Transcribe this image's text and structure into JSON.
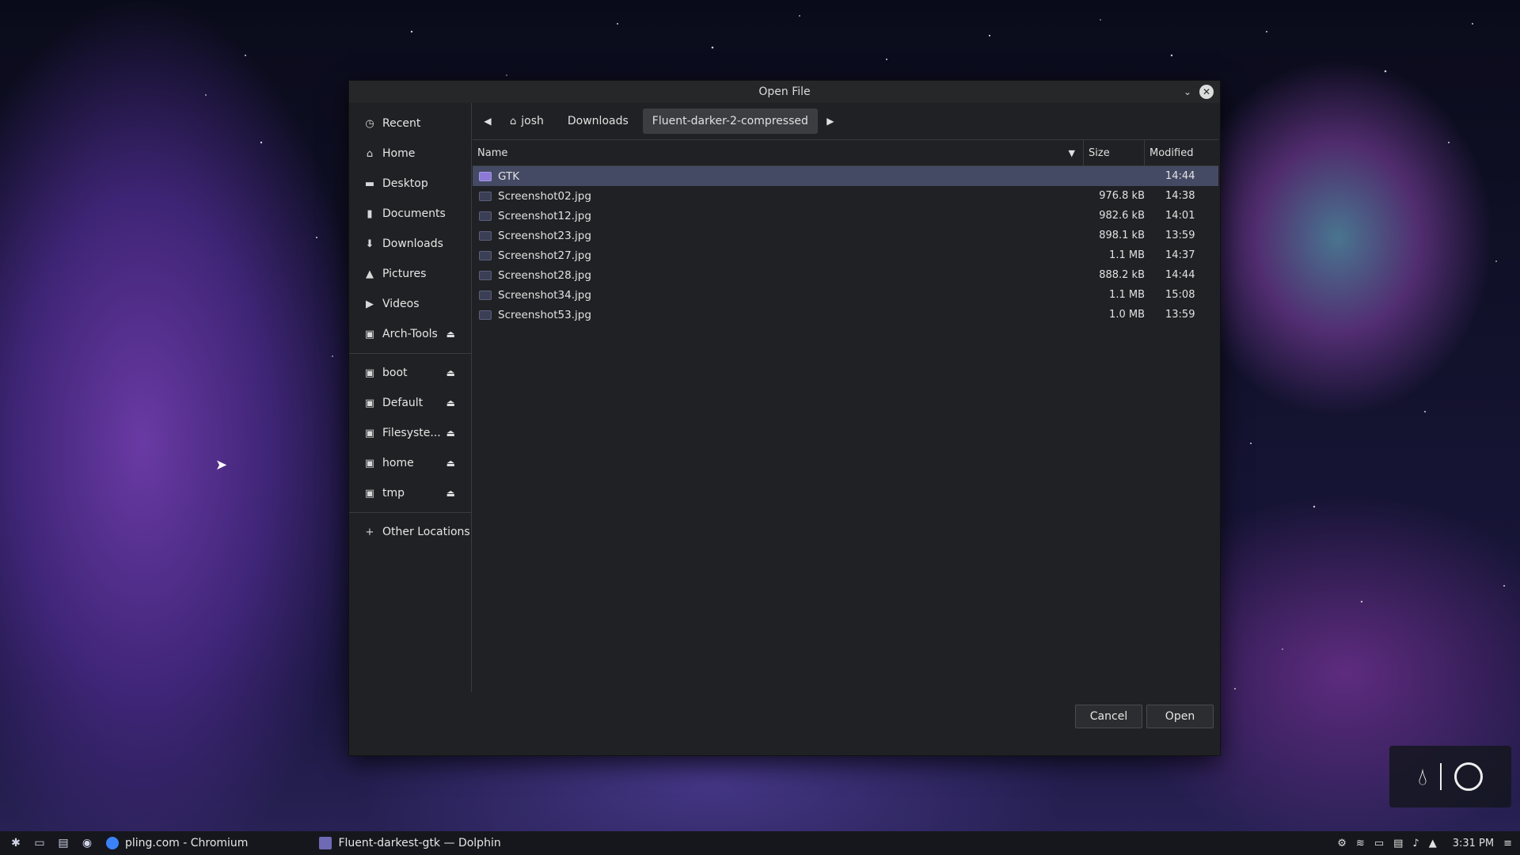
{
  "dialog": {
    "title": "Open File",
    "sidebar": [
      {
        "label": "Recent",
        "icon": "clock-icon",
        "eject": false
      },
      {
        "label": "Home",
        "icon": "home-icon",
        "eject": false
      },
      {
        "label": "Desktop",
        "icon": "desktop-icon",
        "eject": false
      },
      {
        "label": "Documents",
        "icon": "document-icon",
        "eject": false
      },
      {
        "label": "Downloads",
        "icon": "download-icon",
        "eject": false
      },
      {
        "label": "Pictures",
        "icon": "picture-icon",
        "eject": false
      },
      {
        "label": "Videos",
        "icon": "video-icon",
        "eject": false
      },
      {
        "label": "Arch-Tools",
        "icon": "drive-icon",
        "eject": true
      }
    ],
    "mounts": [
      {
        "label": "boot",
        "icon": "drive-icon",
        "eject": true
      },
      {
        "label": "Default",
        "icon": "drive-icon",
        "eject": true
      },
      {
        "label": "Filesyste...",
        "icon": "drive-icon",
        "eject": true
      },
      {
        "label": "home",
        "icon": "drive-icon",
        "eject": true
      },
      {
        "label": "tmp",
        "icon": "drive-icon",
        "eject": true
      }
    ],
    "other_locations": "Other Locations",
    "breadcrumbs": [
      "josh",
      "Downloads",
      "Fluent-darker-2-compressed"
    ],
    "active_crumb": "Fluent-darker-2-compressed",
    "columns": {
      "name": "Name",
      "size": "Size",
      "modified": "Modified"
    },
    "files": [
      {
        "name": "GTK",
        "size": "",
        "modified": "14:44",
        "type": "folder",
        "selected": true
      },
      {
        "name": "Screenshot02.jpg",
        "size": "976.8 kB",
        "modified": "14:38",
        "type": "image",
        "selected": false
      },
      {
        "name": "Screenshot12.jpg",
        "size": "982.6 kB",
        "modified": "14:01",
        "type": "image",
        "selected": false
      },
      {
        "name": "Screenshot23.jpg",
        "size": "898.1 kB",
        "modified": "13:59",
        "type": "image",
        "selected": false
      },
      {
        "name": "Screenshot27.jpg",
        "size": "1.1 MB",
        "modified": "14:37",
        "type": "image",
        "selected": false
      },
      {
        "name": "Screenshot28.jpg",
        "size": "888.2 kB",
        "modified": "14:44",
        "type": "image",
        "selected": false
      },
      {
        "name": "Screenshot34.jpg",
        "size": "1.1 MB",
        "modified": "15:08",
        "type": "image",
        "selected": false
      },
      {
        "name": "Screenshot53.jpg",
        "size": "1.0 MB",
        "modified": "13:59",
        "type": "image",
        "selected": false
      }
    ],
    "cancel_label": "Cancel",
    "open_label": "Open"
  },
  "taskbar": {
    "tasks": [
      {
        "label": "pling.com - Chromium",
        "icon": "chromium-icon"
      },
      {
        "label": "Fluent-darkest-gtk — Dolphin",
        "icon": "dolphin-icon"
      }
    ],
    "clock": "3:31 PM"
  }
}
